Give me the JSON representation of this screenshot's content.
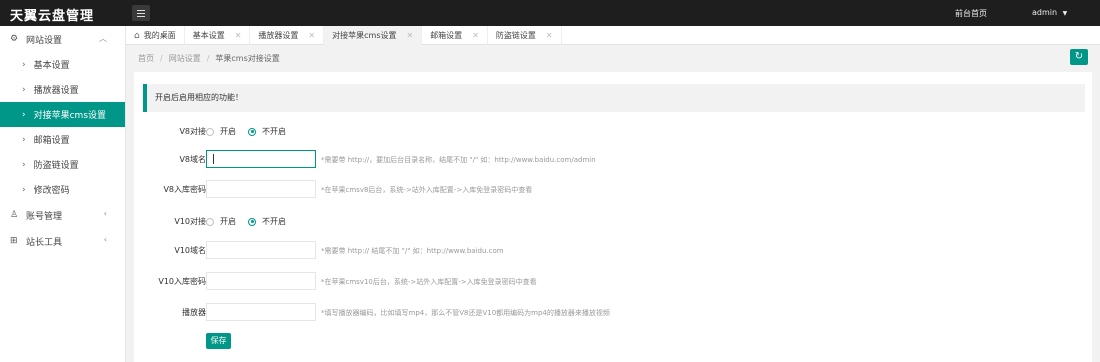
{
  "header": {
    "title": "天翼云盘管理",
    "front_link": "前台首页",
    "user": "admin",
    "user_caret": "▼"
  },
  "sidebar": {
    "groups": [
      {
        "label": "网站设置",
        "icon": "gear-icon",
        "expanded": true
      },
      {
        "label": "账号管理",
        "icon": "user-icon",
        "expanded": false
      },
      {
        "label": "站长工具",
        "icon": "grid-icon",
        "expanded": false
      }
    ],
    "items": [
      {
        "label": "基本设置"
      },
      {
        "label": "播放器设置"
      },
      {
        "label": "对接苹果cms设置"
      },
      {
        "label": "邮箱设置"
      },
      {
        "label": "防盗链设置"
      },
      {
        "label": "修改密码"
      }
    ]
  },
  "tabs": [
    {
      "label": "我的桌面"
    },
    {
      "label": "基本设置"
    },
    {
      "label": "播放器设置"
    },
    {
      "label": "对接苹果cms设置"
    },
    {
      "label": "邮箱设置"
    },
    {
      "label": "防盗链设置"
    }
  ],
  "breadcrumb": {
    "items": [
      "首页",
      "网站设置",
      "苹果cms对接设置"
    ],
    "separator": "/"
  },
  "notice": "开启后启用相应的功能！",
  "form": {
    "v8_dock": {
      "label": "V8对接",
      "options": [
        "开启",
        "不开启"
      ],
      "selected": "不开启"
    },
    "v8_domain": {
      "label": "V8域名",
      "value": "",
      "hint": "*需要带 http://，要加后台目录名称，结尾不加 \"/\" 如：http://www.baidu.com/admin"
    },
    "v8_password": {
      "label": "V8入库密码",
      "value": "",
      "hint": "*在苹果cmsv8后台，系统->站外入库配置->入库免登录密码中查看"
    },
    "v10_dock": {
      "label": "V10对接",
      "options": [
        "开启",
        "不开启"
      ],
      "selected": "不开启"
    },
    "v10_domain": {
      "label": "V10域名",
      "value": "",
      "hint": "*需要带 http:// 结尾不加 \"/\" 如：http://www.baidu.com"
    },
    "v10_password": {
      "label": "V10入库密码",
      "value": "",
      "hint": "*在苹果cmsv10后台，系统->站外入库配置->入库免登录密码中查看"
    },
    "player": {
      "label": "播放器",
      "value": "",
      "hint": "*填写播放器编码，比如填写mp4，那么不管V8还是V10都用编码为mp4的播放器来播放视频"
    },
    "save_label": "保存"
  },
  "colors": {
    "accent": "#009688",
    "header_bg": "#1e1e1e"
  }
}
